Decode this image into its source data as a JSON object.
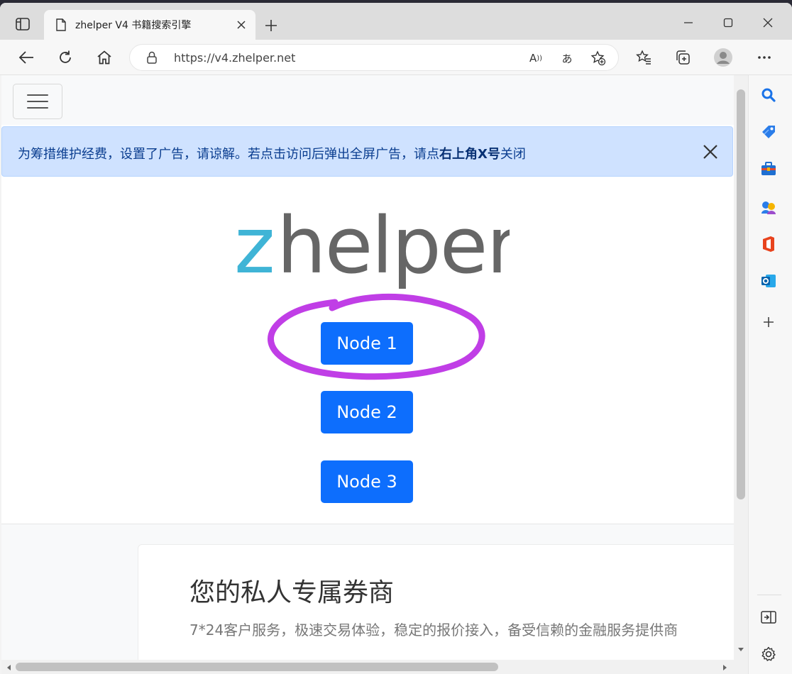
{
  "browser": {
    "tab_title": "zhelper V4 书籍搜索引擎",
    "url": "https://v4.zhelper.net"
  },
  "notice": {
    "text_before": "为筹措维护经费，设置了广告，请谅解。若点击访问后弹出全屏广告，请点",
    "text_bold": "右上角X号",
    "text_after": "关闭"
  },
  "logo": {
    "text": "zhelper",
    "accent_color": "#3fb4d6",
    "main_color": "#666666"
  },
  "nodes": [
    {
      "label": "Node 1"
    },
    {
      "label": "Node 2"
    },
    {
      "label": "Node 3"
    }
  ],
  "ad": {
    "title": "您的私人专属券商",
    "subtitle": "7*24客户服务，极速交易体验，稳定的报价接入，备受信赖的金融服务提供商"
  },
  "colors": {
    "primary_button": "#0d6efd",
    "notice_bg": "#cfe2ff",
    "highlight_stroke": "#c03ee6"
  },
  "icons": {
    "sidebar": [
      "search-icon",
      "tag-icon",
      "briefcase-icon",
      "games-icon",
      "office-icon",
      "outlook-icon",
      "add-icon",
      "exit-sidebar-icon",
      "settings-icon"
    ]
  }
}
